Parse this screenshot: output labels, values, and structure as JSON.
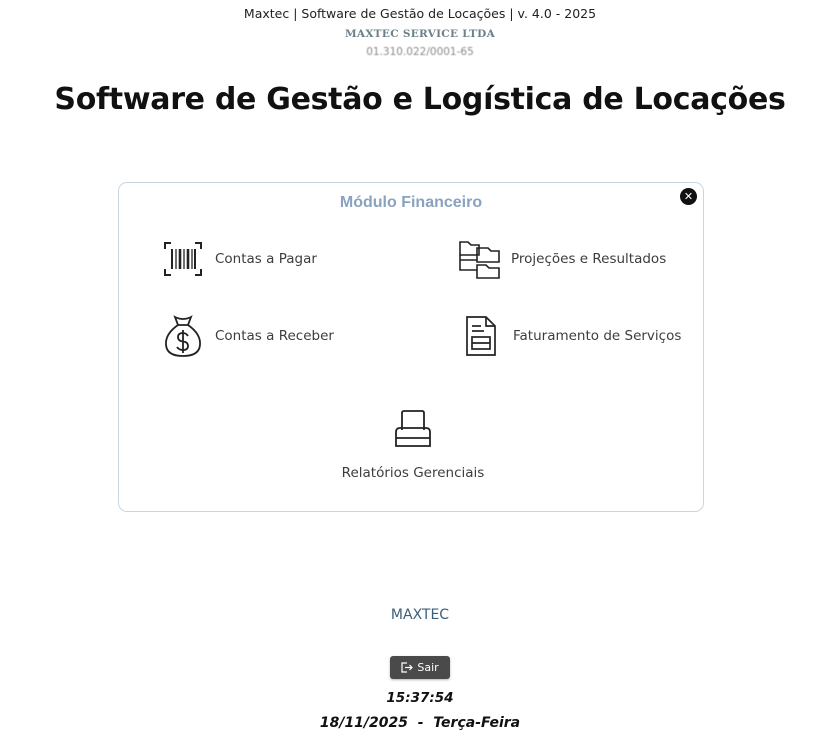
{
  "header": {
    "top_line": "Maxtec |  Software de Gestão de Locações | v. 4.0 - 2025",
    "company": "MAXTEC SERVICE LTDA",
    "cnpj": "01.310.022/0001-65",
    "title": "Software de Gestão e Logística de Locações"
  },
  "module": {
    "title": "Módulo Financeiro",
    "close_icon": "close-circle-icon",
    "items": [
      {
        "label": "Contas a Pagar",
        "icon": "barcode-icon"
      },
      {
        "label": "Projeções e Resultados",
        "icon": "folder-tree-icon"
      },
      {
        "label": "Contas a Receber",
        "icon": "money-bag-icon"
      },
      {
        "label": "Faturamento de Serviços",
        "icon": "invoice-icon"
      },
      {
        "label": "Relatórios Gerenciais",
        "icon": "printer-icon"
      }
    ]
  },
  "footer": {
    "brand": "MAXTEC",
    "exit_label": "Sair",
    "exit_icon": "logout-icon",
    "time": "15:37:54",
    "date": "18/11/2025  -  Terça-Feira"
  },
  "colors": {
    "panel_title": "#8aa2be",
    "panel_border": "#c9d6e2",
    "brand": "#3b5f7a",
    "exit_button": "#4a4a4a"
  }
}
